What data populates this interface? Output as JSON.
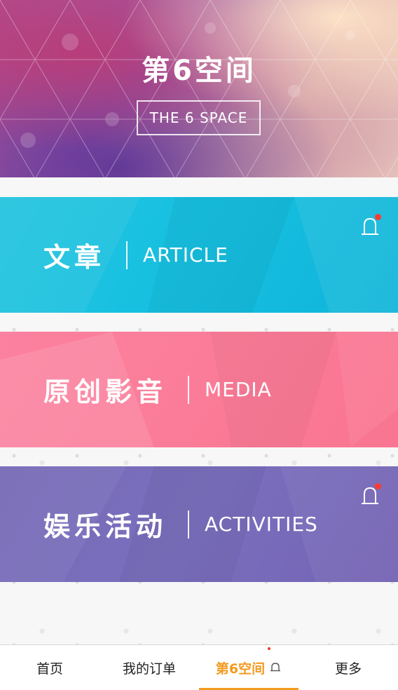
{
  "header": {
    "title": "第6空间",
    "subtitle": "THE 6 SPACE"
  },
  "sections": [
    {
      "id": "article",
      "title_cn": "文章",
      "title_en": "ARTICLE",
      "has_notification": true,
      "icon": "bell-icon",
      "color": "#17c0e0"
    },
    {
      "id": "media",
      "title_cn": "原创影音",
      "title_en": "MEDIA",
      "has_notification": false,
      "icon": "",
      "color": "#fb7c98"
    },
    {
      "id": "activities",
      "title_cn": "娱乐活动",
      "title_en": "ACTIVITIES",
      "has_notification": true,
      "icon": "bell-icon",
      "color": "#7a6fbd"
    }
  ],
  "tabbar": {
    "tabs": [
      {
        "label": "首页",
        "active": false
      },
      {
        "label": "我的订单",
        "active": false
      },
      {
        "label": "第6空间",
        "active": true,
        "icon": "bell-icon"
      },
      {
        "label": "更多",
        "active": false
      }
    ],
    "active_color": "#f39a1f",
    "notification_color": "#e83a2f"
  }
}
